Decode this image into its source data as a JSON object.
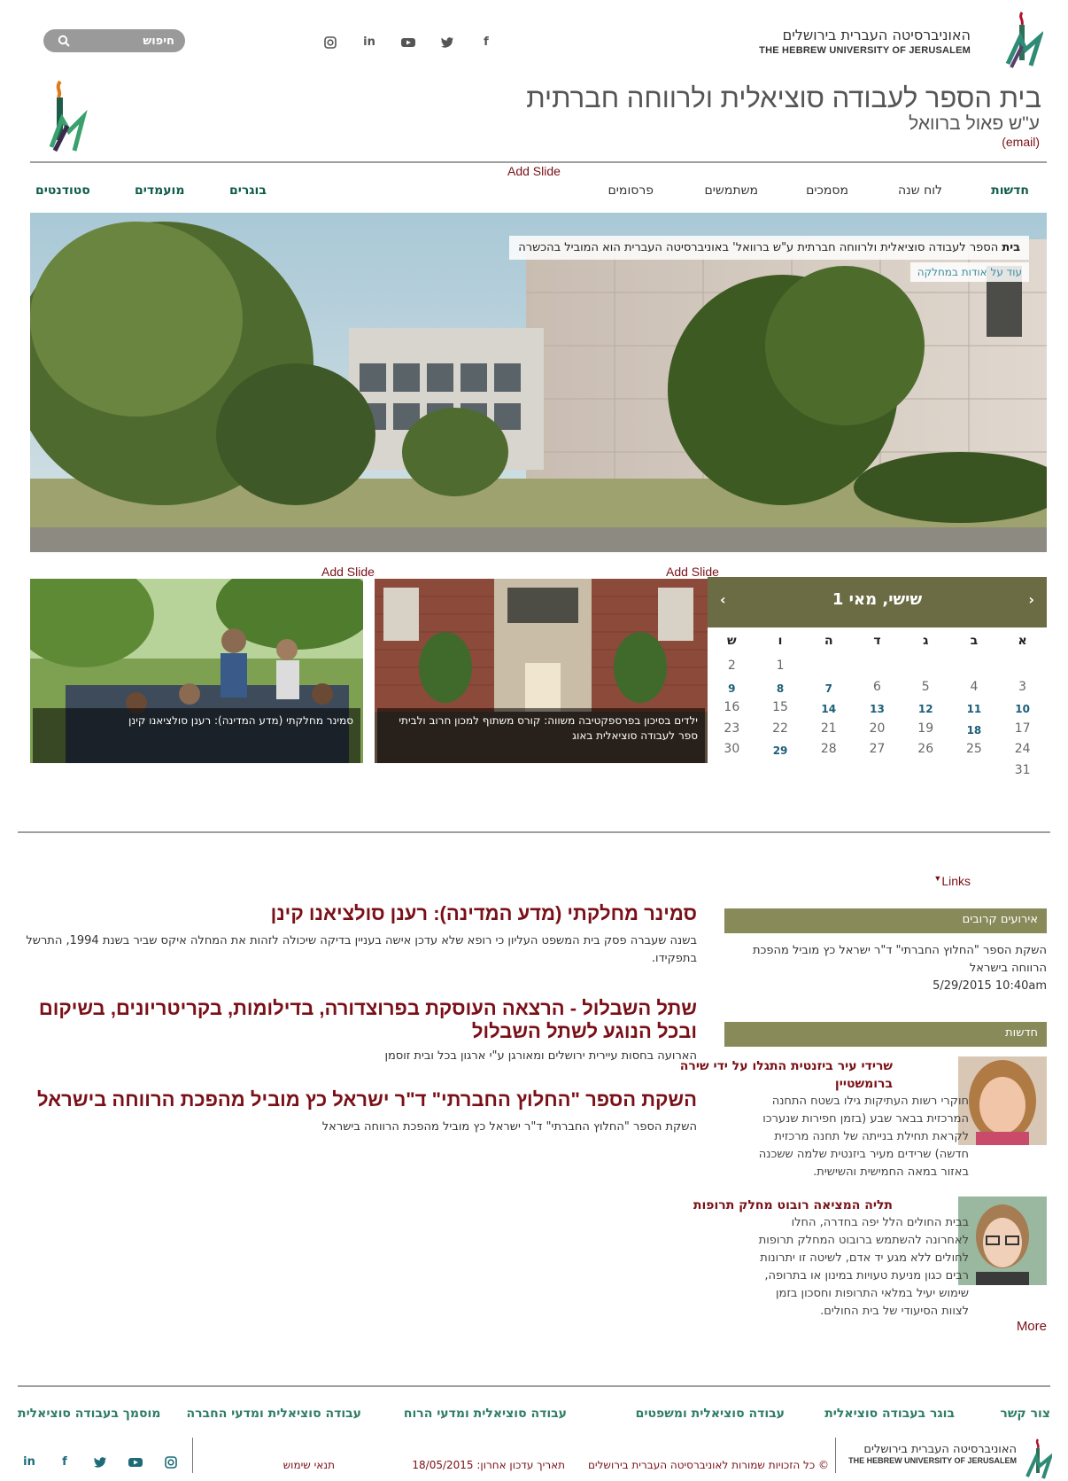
{
  "header": {
    "search": {
      "placeholder": "חיפוש"
    },
    "social": {
      "instagram": "instagram-icon",
      "linkedin": "in",
      "youtube": "youtube-icon",
      "twitter": "twitter-icon",
      "facebook": "f"
    },
    "university": {
      "name_he": "האוניברסיטה העברית בירושלים",
      "name_en": "THE HEBREW UNIVERSITY OF JERUSALEM"
    },
    "title": "בית הספר לעבודה סוציאלית ולרווחה חברתית",
    "subtitle": "ע\"ש פאול ברוואל",
    "email": "(email)"
  },
  "add_slide": "Add Slide",
  "nav": {
    "right_items": [
      "חדשות",
      "לוח שנה",
      "מסמכים",
      "משתמשים",
      "פרסומים"
    ],
    "left_items": [
      "בוגרים",
      "מועמדים",
      "סטודנטים"
    ]
  },
  "hero": {
    "caption_bold": "בית",
    "caption": "הספר לעבודה סוציאלית ולרווחה חברתית ע\"ש ברוואל' באוניברסיטה העברית הוא המוביל בהכשרה",
    "more": "עוד על אודות במחלקה"
  },
  "thumbs": [
    {
      "caption": "ילדים בסיכון בפרספקטיבה משווה: קורס משתוף למכון חרוב ולביתי ספר לעבודה סוציאלית באוג"
    },
    {
      "caption": "סמינר מחלקתי (מדע המדינה): רענן סולציאנו קינן"
    }
  ],
  "calendar": {
    "title": "שישי, מאי 1",
    "days": [
      "א",
      "ב",
      "ג",
      "ד",
      "ה",
      "ו",
      "ש"
    ],
    "weeks": [
      [
        "",
        "",
        "",
        "",
        "",
        "1",
        "2"
      ],
      [
        "3",
        "4",
        "5",
        "6",
        "7",
        "8",
        "9"
      ],
      [
        "10",
        "11",
        "12",
        "13",
        "14",
        "15",
        "16"
      ],
      [
        "17",
        "18",
        "19",
        "20",
        "21",
        "22",
        "23"
      ],
      [
        "24",
        "25",
        "26",
        "27",
        "28",
        "29",
        "30"
      ],
      [
        "31",
        "",
        "",
        "",
        "",
        "",
        ""
      ]
    ],
    "event_days": [
      "7",
      "8",
      "9",
      "10",
      "11",
      "12",
      "13",
      "14",
      "18",
      "29"
    ]
  },
  "links_label": "Links",
  "upcoming": {
    "heading": "אירועים קרובים",
    "text": "השקת הספר \"החלוץ החברתי\" ד\"ר ישראל כץ מוביל מהפכת הרווחה בישראל",
    "date": "5/29/2015 10:40am"
  },
  "news": {
    "heading": "חדשות",
    "items": [
      {
        "title": "שרידי עיר ביזנטית התגלו על ידי שירה ברומשטיין",
        "body": "חוקרי רשות העתיקות גילו בשטח התחנה המרכזית בבאר שבע (בזמן חפירות שנערכו לקראת תחילת בנייתה של תחנה מרכזית חדשה) שרידים מעיר ביזנטית שלמה ששכנה באזור במאה החמישית והשישית."
      },
      {
        "title": "תליה המציאה רובוט מחלק תרופות",
        "body": "בבית החולים הלל יפה בחדרה, החלו לאחרונה להשתמש ברובוט המחלק תרופות לחולים ללא מגע יד אדם, לשיטה זו יתרונות רבים כגון מניעת טעויות במינון או בתרופה, שימוש יעיל במלאי התרופות וחסכון בזמן לצוות הסיעודי של בית החולים."
      }
    ],
    "more": "More"
  },
  "articles": [
    {
      "title": "סמינר מחלקתי (מדע המדינה): רענן סולציאנו קינן",
      "body": "בשנה שעברה פסק בית המשפט העליון כי רופא שלא עדכן אישה בעניין בדיקה שיכולה לזהות את המחלה איקס שביר בשנת 1994, התרשל בתפקידו."
    },
    {
      "title": "שתל השבלול - הרצאה העוסקת בפרוצדורה, בדילומות, בקריטריונים, בשיקום ובכל הנוגע לשתל השבלול",
      "body": "הארועה בחסות עיירית ירושלים ומאורגן ע\"י ארגון בכל ובית זוסמן"
    },
    {
      "title": "השקת הספר \"החלוץ החברתי\" ד\"ר ישראל כץ מוביל מהפכת הרווחה בישראל",
      "body": "השקת הספר \"החלוץ החברתי\" ד\"ר ישראל כץ מוביל מהפכת הרווחה בישראל"
    }
  ],
  "footer": {
    "links": [
      "צור קשר",
      "בוגר בעבודה סוציאלית",
      "עבודה סוציאלית ומשפטים",
      "עבודה סוציאלית ומדעי הרוח",
      "עבודה סוציאלית ומדעי החברה",
      "מוסמך בעבודה סוציאלית"
    ],
    "copyright": "© כל הזכויות שמורות לאוניברסיטה העברית בירושלים",
    "last_update": "תאריך עדכון אחרון: 18/05/2015",
    "terms": "תנאי שימוש",
    "social": {
      "linkedin": "in",
      "facebook": "f"
    }
  },
  "colors": {
    "accent": "#7a1017",
    "teal": "#0f5c4a",
    "olive": "#6b6b44",
    "olive_light": "#888a5a"
  }
}
